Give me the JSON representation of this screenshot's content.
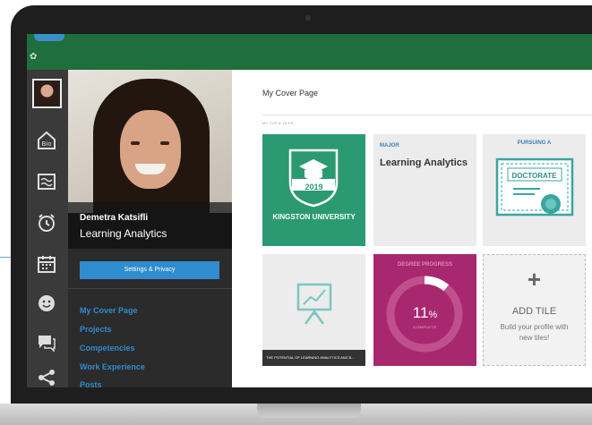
{
  "profile": {
    "name": "Demetra Katsifli",
    "major": "Learning Analytics",
    "settings_label": "Settings & Privacy"
  },
  "nav": {
    "items": [
      {
        "label": "My Cover Page"
      },
      {
        "label": "Projects"
      },
      {
        "label": "Competencies"
      },
      {
        "label": "Work Experience"
      },
      {
        "label": "Posts"
      }
    ]
  },
  "rail_icons": [
    "avatar",
    "bio-icon",
    "wave-icon",
    "alarm-clock-icon",
    "calendar-icon",
    "smiley-icon",
    "chat-icon",
    "share-icon"
  ],
  "main": {
    "title": "My Cover Page",
    "section_label": "MY TOP 6 TILES"
  },
  "tiles": {
    "university": {
      "year": "2019",
      "name": "KINGSTON UNIVERSITY"
    },
    "major": {
      "label": "MAJOR",
      "value": "Learning Analytics"
    },
    "pursuing": {
      "label": "PURSUING A",
      "degree": "DOCTORATE"
    },
    "project": {
      "caption": "THE POTENTIAL OF LEARNING ANALYTICS AND B..."
    },
    "progress": {
      "label": "DEGREE PROGRESS",
      "percent": 11,
      "percent_text": "11",
      "percent_sign": "%",
      "status": "COMPLETE"
    },
    "add": {
      "symbol": "+",
      "title": "ADD TILE",
      "line1": "Build your profile with",
      "line2": "new tiles!"
    }
  },
  "colors": {
    "topbar": "#1f6e3c",
    "accent_blue": "#2f8ccf",
    "university_tile": "#2b9a72",
    "progress_tile": "#a8286f"
  }
}
